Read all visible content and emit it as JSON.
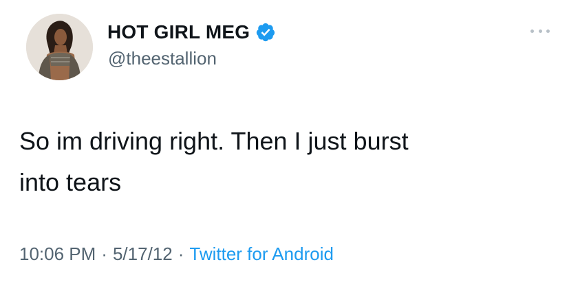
{
  "user": {
    "display_name": "HOT GIRL MEG",
    "handle": "@theestallion",
    "verified": true,
    "avatar_icon": "profile-photo"
  },
  "tweet": {
    "text_line1": "So im driving right. Then I just burst",
    "text_line2": "into tears"
  },
  "meta": {
    "time": "10:06 PM",
    "separator": "·",
    "date": "5/17/12",
    "source": "Twitter for Android"
  },
  "colors": {
    "text": "#0f1419",
    "secondary": "#536471",
    "accent": "#1d9bf0"
  }
}
